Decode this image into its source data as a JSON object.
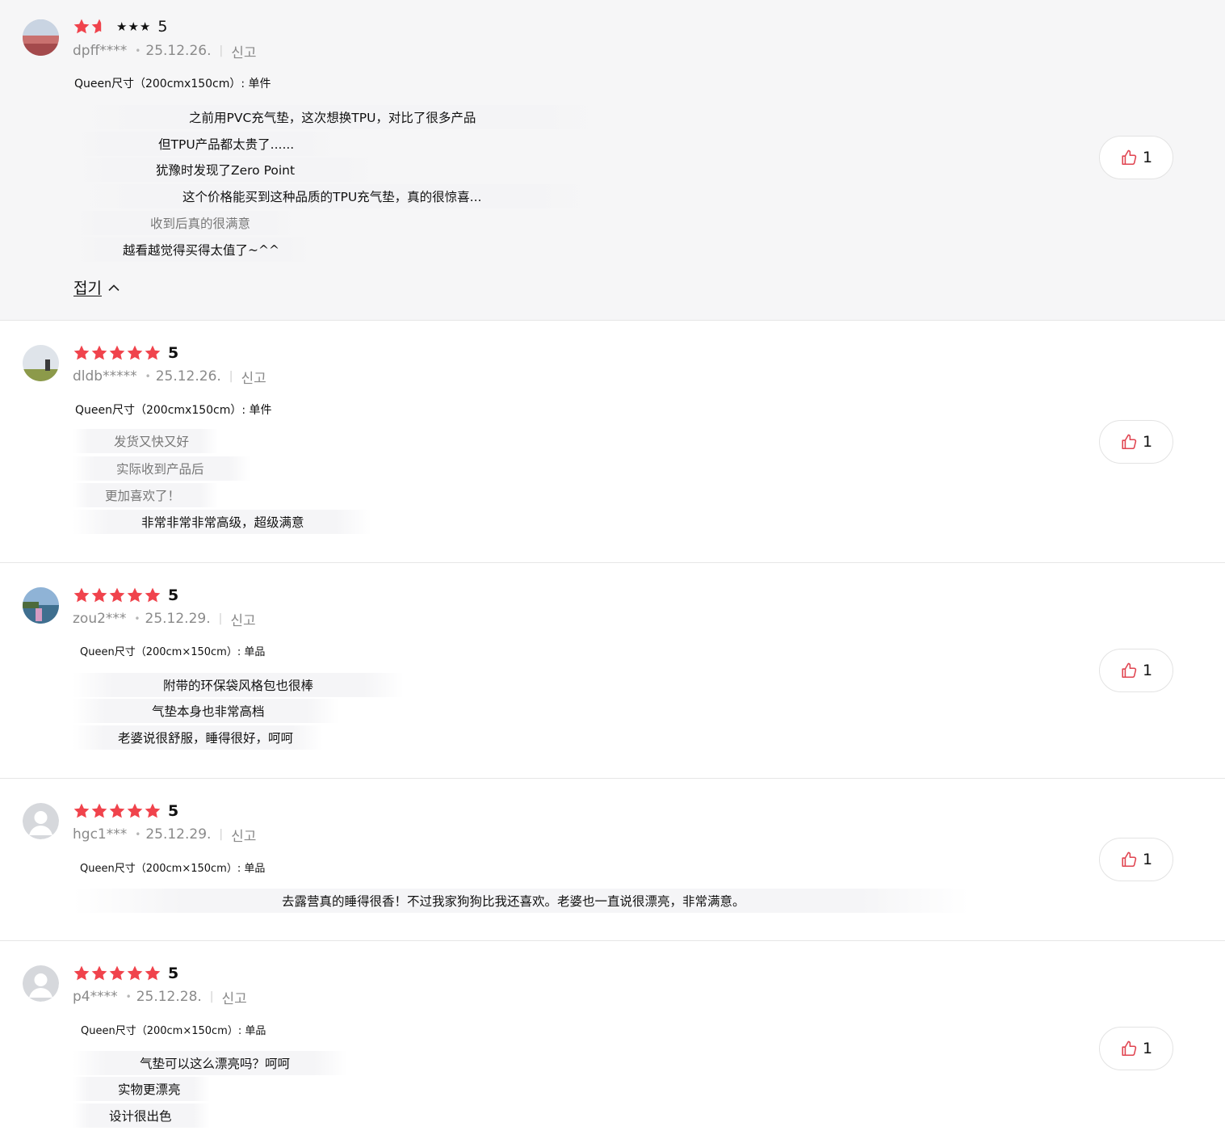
{
  "reviews": [
    {
      "rating": 5,
      "rating_label": "5",
      "stars_text": "★★★",
      "user": "dpff****",
      "date": "25.12.26.",
      "report": "신고",
      "option": "Queen尺寸（200cmx150cm）: 单件",
      "lines": [
        "之前用PVC充气垫，这次想换TPU，对比了很多产品",
        "但TPU产品都太贵了......",
        "犹豫时发现了Zero Point",
        "这个价格能买到这种品质的TPU充气垫，真的很惊喜...",
        "收到后真的很满意",
        "越看越觉得买得太值了~^^"
      ],
      "collapse_label": "접기",
      "likes": "1"
    },
    {
      "rating": 5,
      "rating_label": "5",
      "user": "dldb*****",
      "date": "25.12.26.",
      "report": "신고",
      "option": "Queen尺寸（200cmx150cm）: 单件",
      "lines": [
        "发货又快又好",
        "实际收到产品后",
        "更加喜欢了！",
        "非常非常非常高级，超级满意"
      ],
      "likes": "1"
    },
    {
      "rating": 5,
      "rating_label": "5",
      "user": "zou2***",
      "date": "25.12.29.",
      "report": "신고",
      "option": "Queen尺寸（200cm×150cm）: 单品",
      "lines": [
        "附带的环保袋风格包也很棒",
        "气垫本身也非常高档",
        "老婆说很舒服，睡得很好，呵呵"
      ],
      "likes": "1"
    },
    {
      "rating": 5,
      "rating_label": "5",
      "user": "hgc1***",
      "date": "25.12.29.",
      "report": "신고",
      "option": "Queen尺寸（200cm×150cm）: 单品",
      "lines": [
        "去露营真的睡得很香！不过我家狗狗比我还喜欢。老婆也一直说很漂亮，非常满意。"
      ],
      "likes": "1"
    },
    {
      "rating": 5,
      "rating_label": "5",
      "user": "p4****",
      "date": "25.12.28.",
      "report": "신고",
      "option": "Queen尺寸（200cm×150cm）: 单品",
      "lines": [
        "气垫可以这么漂亮吗？呵呵",
        "实物更漂亮",
        "设计很出色"
      ],
      "likes": "1"
    }
  ],
  "colors": {
    "star": "#f0434c",
    "star_empty": "#f8c5c8",
    "text": "#111111",
    "muted": "#8a8a8a",
    "expanded_bg": "#f6f6f7"
  },
  "icons": {
    "star": "star-icon",
    "like": "thumbs-up-icon",
    "collapse": "chevron-up-icon",
    "avatar_default": "default-avatar-icon"
  }
}
